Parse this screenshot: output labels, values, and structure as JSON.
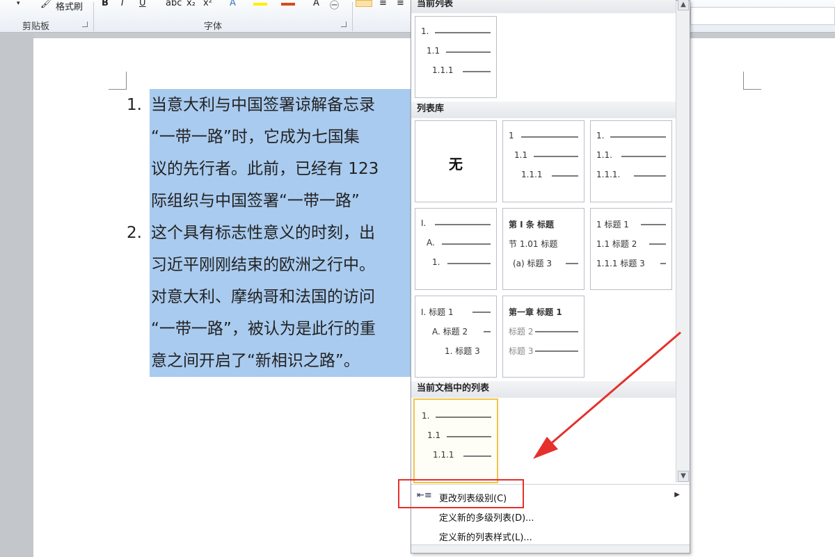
{
  "ribbon": {
    "format_painter_label": "格式刷",
    "clipboard_group": "剪贴板",
    "font_group": "字体",
    "bold": "B",
    "italic": "I",
    "underline": "U",
    "highlight_color": "#ffee00",
    "font_color": "#d84b1a"
  },
  "document": {
    "items": [
      {
        "number": "1.",
        "lines": [
          "当意大利与中国签署谅解备忘录",
          "“一带一路”时，它成为七国集",
          "议的先行者。此前，已经有 123",
          "际组织与中国签署“一带一路”"
        ]
      },
      {
        "number": "2.",
        "lines": [
          "这个具有标志性意义的时刻，出",
          "习近平刚刚结束的欧洲之行中。",
          "对意大利、摩纳哥和法国的访问",
          "“一带一路”，被认为是此行的重",
          "意之间开启了“新相识之路”。"
        ]
      }
    ]
  },
  "gallery": {
    "current_list_heading": "当前列表",
    "list_library_heading": "列表库",
    "doc_lists_heading": "当前文档中的列表",
    "none_label": "无",
    "current_tile": [
      "1.",
      "1.1",
      "1.1.1"
    ],
    "tiles": [
      {
        "rows": [
          "1",
          "1.1",
          "1.1.1"
        ]
      },
      {
        "rows": [
          "1.",
          "1.1.",
          "1.1.1."
        ]
      },
      {
        "rows": [
          "I.",
          "A.",
          "1."
        ]
      },
      {
        "rows": [
          "第 I 条 标题",
          "节 1.01 标题",
          "(a) 标题 3"
        ]
      },
      {
        "rows": [
          "1 标题 1",
          "1.1 标题 2",
          "1.1.1 标题 3"
        ]
      },
      {
        "rows": [
          "I. 标题 1",
          "A. 标题 2",
          "1. 标题 3"
        ]
      },
      {
        "rows": [
          "第一章 标题 1",
          "标题 2",
          "标题 3"
        ]
      }
    ],
    "doc_tile": [
      "1.",
      "1.1",
      "1.1.1"
    ]
  },
  "menu": {
    "change_level": "更改列表级别(C)",
    "define_multilevel": "定义新的多级列表(D)...",
    "define_style": "定义新的列表样式(L)..."
  },
  "colors": {
    "selection": "#a9cbef",
    "highlight_border": "#e5302c",
    "selected_tile": "#f0c44a"
  }
}
